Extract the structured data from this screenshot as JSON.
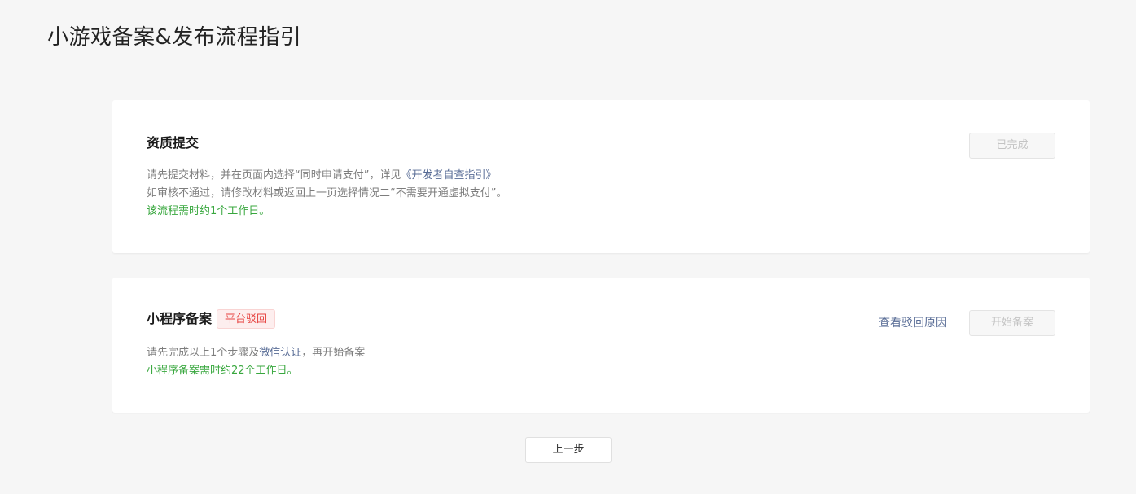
{
  "page": {
    "title": "小游戏备案&发布流程指引"
  },
  "cards": [
    {
      "title": "资质提交",
      "button_label": "已完成",
      "desc_line1_prefix": "请先提交材料，并在页面内选择“同时申请支付”，详见",
      "desc_line1_link": "《开发者自查指引》",
      "desc_line2": "如审核不通过，请修改材料或返回上一页选择情况二“不需要开通虚拟支付”。",
      "desc_line3": "该流程需时约1个工作日。"
    },
    {
      "title": "小程序备案",
      "status_tag": "平台驳回",
      "link_label": "查看驳回原因",
      "button_label": "开始备案",
      "desc_line1_prefix": "请先完成以上1个步骤及",
      "desc_line1_link": "微信认证",
      "desc_line1_suffix": "，再开始备案",
      "desc_line2": "小程序备案需时约22个工作日。"
    }
  ],
  "footer": {
    "prev_label": "上一步"
  },
  "colors": {
    "accent_link": "#576b95",
    "success_green": "#38a73e",
    "reject_red": "#e64340"
  }
}
